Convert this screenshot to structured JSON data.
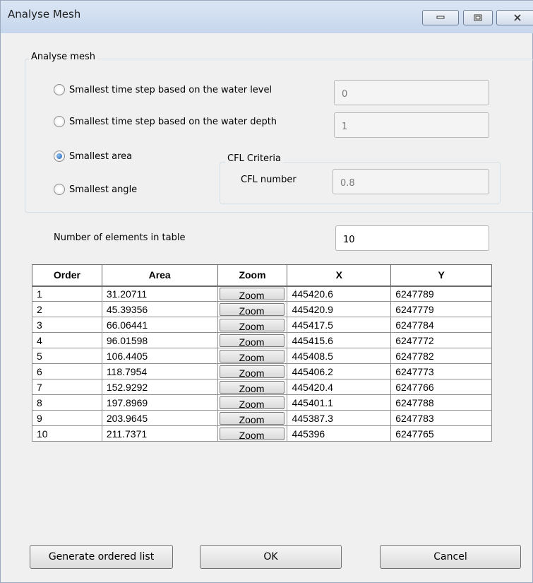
{
  "window": {
    "title": "Analyse Mesh",
    "controls": {
      "minimize_icon": "minimize-icon",
      "maximize_icon": "maximize-icon",
      "close_icon": "close-icon"
    }
  },
  "analyse_group": {
    "title": "Analyse mesh",
    "options": [
      {
        "label": "Smallest time step based on the water level",
        "checked": false,
        "value": "0"
      },
      {
        "label": "Smallest time step based on the water depth",
        "checked": false,
        "value": "1"
      },
      {
        "label": "Smallest area",
        "checked": true
      },
      {
        "label": "Smallest angle",
        "checked": false
      }
    ]
  },
  "cfl_group": {
    "title": "CFL Criteria",
    "cfl_label": "CFL number",
    "cfl_value": "0.8"
  },
  "elements": {
    "label": "Number of elements in table",
    "value": "10"
  },
  "table": {
    "headers": [
      "Order",
      "Area",
      "Zoom",
      "X",
      "Y"
    ],
    "zoom_label": "Zoom",
    "rows": [
      [
        "1",
        "31.20711",
        "445420.6",
        "6247789"
      ],
      [
        "2",
        "45.39356",
        "445420.9",
        "6247779"
      ],
      [
        "3",
        "66.06441",
        "445417.5",
        "6247784"
      ],
      [
        "4",
        "96.01598",
        "445415.6",
        "6247772"
      ],
      [
        "5",
        "106.4405",
        "445408.5",
        "6247782"
      ],
      [
        "6",
        "118.7954",
        "445406.2",
        "6247773"
      ],
      [
        "7",
        "152.9292",
        "445420.4",
        "6247766"
      ],
      [
        "8",
        "197.8969",
        "445401.1",
        "6247788"
      ],
      [
        "9",
        "203.9645",
        "445387.3",
        "6247783"
      ],
      [
        "10",
        "211.7371",
        "445396",
        "6247765"
      ]
    ]
  },
  "buttons": {
    "generate": "Generate ordered list",
    "ok": "OK",
    "cancel": "Cancel"
  }
}
